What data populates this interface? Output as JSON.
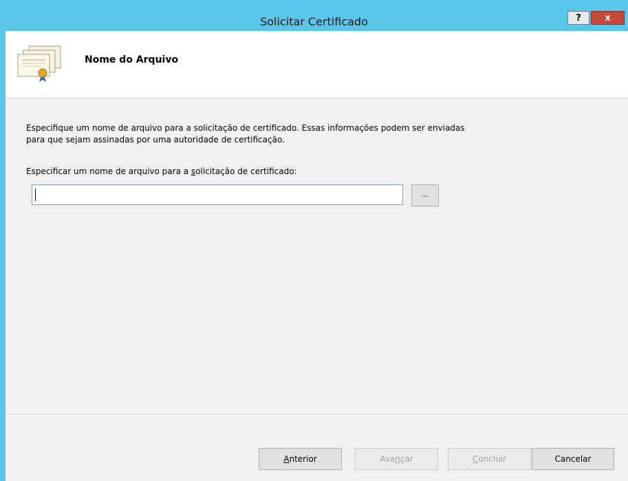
{
  "window": {
    "title": "Solicitar Certificado",
    "help_label": "?",
    "close_label": "x"
  },
  "header": {
    "title": "Nome do Arquivo",
    "icon": "certificate-stack-icon"
  },
  "content": {
    "description_line1": "Especifique um nome de arquivo para a solicitação de certificado. Essas informações podem ser enviadas",
    "description_line2": "para que sejam assinadas por uma autoridade de certificação.",
    "field_label_before": "Especificar um nome de arquivo para a ",
    "field_label_underlined": "s",
    "field_label_after": "olicitação de certificado:",
    "file_value": "",
    "browse_label": "..."
  },
  "footer": {
    "prev": {
      "u": "A",
      "rest": "nterior"
    },
    "next": {
      "before": "Ava",
      "u": "n",
      "after": "çar"
    },
    "finish": {
      "u": "C",
      "rest": "oncluir"
    },
    "cancel": "Cancelar"
  },
  "colors": {
    "titlebar": "#5ac6ea",
    "close": "#c7493a",
    "body": "#f0f0f0"
  }
}
